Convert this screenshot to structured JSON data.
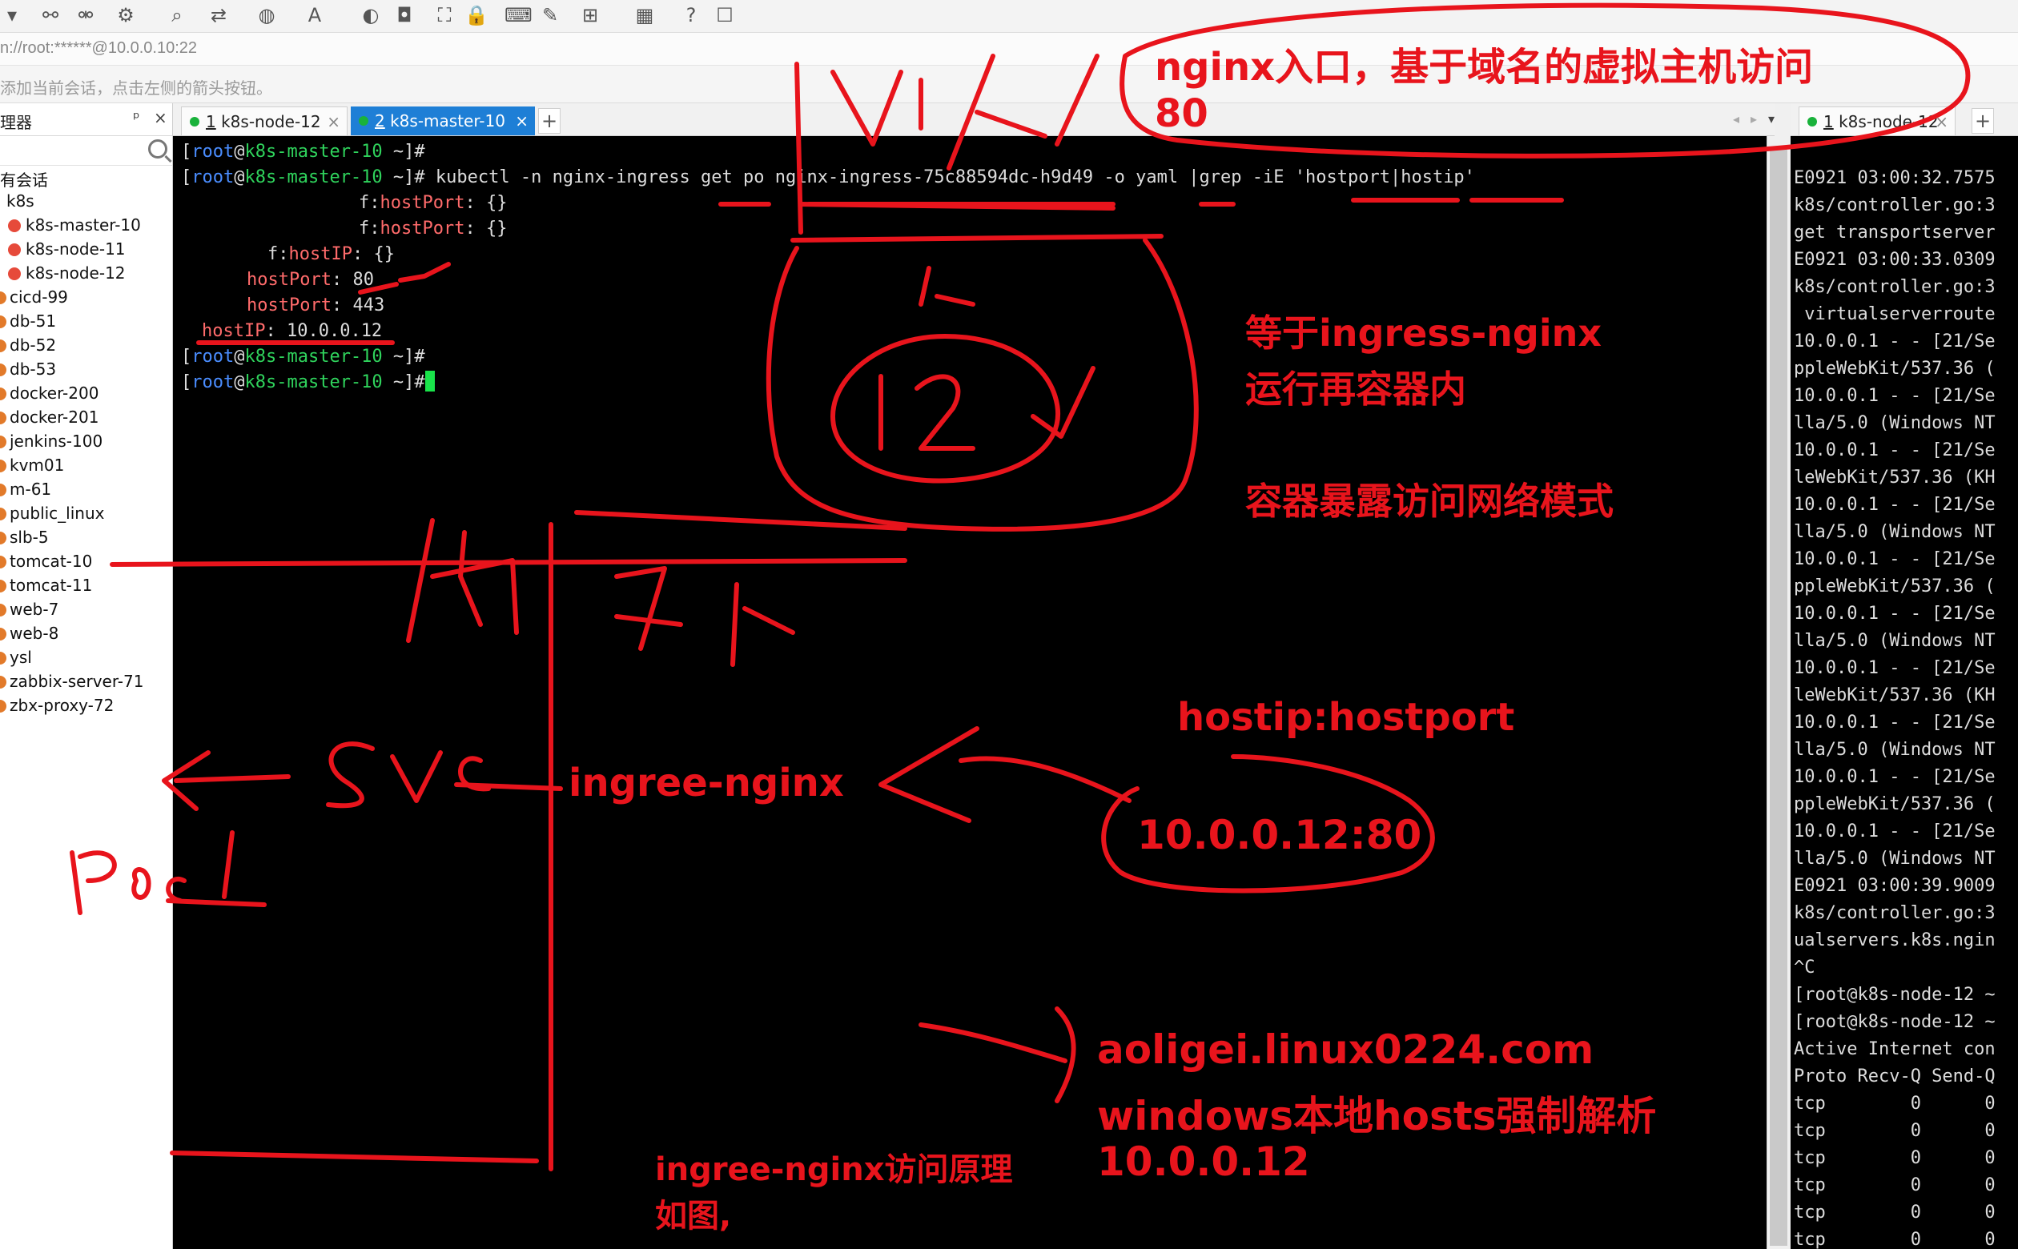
{
  "address": "n://root:******@10.0.0.10:22",
  "hint": "添加当前会话，点击左侧的箭头按钮。",
  "sidebar": {
    "title": "理器",
    "pin": "ᵖ",
    "close": "×",
    "sessions_label": "有会话",
    "group": "k8s",
    "k8s_items": [
      "k8s-master-10",
      "k8s-node-11",
      "k8s-node-12"
    ],
    "hosts": [
      "cicd-99",
      "db-51",
      "db-52",
      "db-53",
      "docker-200",
      "docker-201",
      "jenkins-100",
      "kvm01",
      "m-61",
      "public_linux",
      "slb-5",
      "tomcat-10",
      "tomcat-11",
      "web-7",
      "web-8",
      "ysl",
      "zabbix-server-71",
      "zbx-proxy-72"
    ]
  },
  "tabs": {
    "tab1_num": "1",
    "tab1_label": "k8s-node-12",
    "tab2_num": "2",
    "tab2_label": "k8s-master-10",
    "tab3_num": "1",
    "tab3_label": "k8s-node-12",
    "close": "×",
    "add": "+"
  },
  "terminal": {
    "p_open": "[",
    "user": "root",
    "at": "@",
    "host": "k8s-master-10",
    "p_close": " ~]#",
    "command": " kubectl -n nginx-ingress get po nginx-ingress-75c88594dc-h9d49 -o yaml |grep -iE 'hostport|hostip'",
    "line2a": "f:",
    "line2b": "hostPort",
    "line2c": ": {}",
    "line4a": "f:",
    "line4b": "hostIP",
    "line4c": ": {}",
    "line5b": "hostPort",
    "line5c": ": 80",
    "line6b": "hostPort",
    "line6c": ": 443",
    "line7b": "hostIP",
    "line7c": ": 10.0.0.12"
  },
  "right_terminal": [
    "E0921 03:00:32.7575",
    "k8s/controller.go:3",
    "get transportserver",
    "E0921 03:00:33.0309",
    "k8s/controller.go:3",
    " virtualserverroute",
    "10.0.0.1 - - [21/Se",
    "ppleWebKit/537.36 (",
    "10.0.0.1 - - [21/Se",
    "lla/5.0 (Windows NT",
    "10.0.0.1 - - [21/Se",
    "leWebKit/537.36 (KH",
    "10.0.0.1 - - [21/Se",
    "lla/5.0 (Windows NT",
    "10.0.0.1 - - [21/Se",
    "ppleWebKit/537.36 (",
    "10.0.0.1 - - [21/Se",
    "lla/5.0 (Windows NT",
    "10.0.0.1 - - [21/Se",
    "leWebKit/537.36 (KH",
    "10.0.0.1 - - [21/Se",
    "lla/5.0 (Windows NT",
    "10.0.0.1 - - [21/Se",
    "ppleWebKit/537.36 (",
    "10.0.0.1 - - [21/Se",
    "lla/5.0 (Windows NT",
    "E0921 03:00:39.9009",
    "k8s/controller.go:3",
    "ualservers.k8s.ngin",
    "^C",
    "[root@k8s-node-12 ~",
    "[root@k8s-node-12 ~",
    "Active Internet con",
    "Proto Recv-Q Send-Q",
    "tcp        0      0",
    "tcp        0      0",
    "tcp        0      0",
    "tcp        0      0",
    "tcp        0      0",
    "tcp        0      0"
  ],
  "annotations": {
    "top_note_1": "nginx入口，基于域名的虚拟主机访问",
    "top_note_2": "80",
    "ingress_note_1": "等于ingress-nginx",
    "ingress_note_2": "运行再容器内",
    "network_note": "容器暴露访问网络模式",
    "hostip_label": "hostip:hostport",
    "ingree_label": "ingree-nginx",
    "address_label": "10.0.0.12:80",
    "domain_1": "aoligei.linux0224.com",
    "domain_2": "windows本地hosts强制解析",
    "domain_3": "10.0.0.12",
    "principle_1": "ingree-nginx访问原理",
    "principle_2": "如图,"
  },
  "colors": {
    "annotation": "#e8141c",
    "tab_active": "#1e7fd6",
    "prompt_user": "#4a8dff",
    "prompt_host": "#2fd35c",
    "key": "#ff6b6b"
  }
}
